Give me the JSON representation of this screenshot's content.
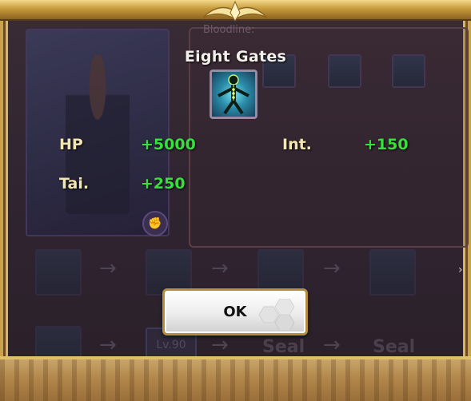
{
  "dialog": {
    "title": "Eight Gates",
    "skill_icon": "eight-gates-skill-icon",
    "stats": [
      {
        "label": "HP",
        "value": "+5000"
      },
      {
        "label": "Int.",
        "value": "+150"
      },
      {
        "label": "Tai.",
        "value": "+250"
      }
    ],
    "ok_label": "OK"
  },
  "background": {
    "bloodline_label": "Bloodline:",
    "level_label": "Lv.90",
    "seal_label_1": "Seal",
    "seal_label_2": "Seal"
  },
  "colors": {
    "frame_gold": "#c9a24a",
    "stat_label": "#f2e6b0",
    "stat_value": "#35e23a",
    "title_text": "#f4f1ea"
  }
}
